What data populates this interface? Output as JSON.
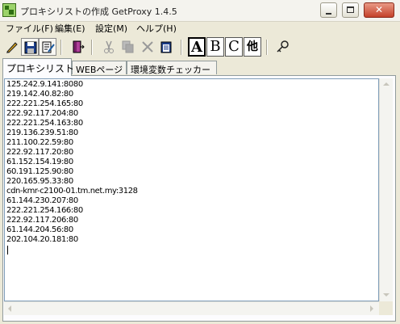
{
  "window": {
    "title": "プロキシリストの作成 GetProxy 1.4.5",
    "close_glyph": "✕"
  },
  "menu": {
    "items": [
      "ファイル(F)",
      "編集(E)",
      "設定(M)",
      "ヘルプ(H)"
    ]
  },
  "toolbar": {
    "icons": [
      "pen-icon",
      "save-icon",
      "edit-icon",
      "exit-icon",
      "cut-icon",
      "copy-icon",
      "delete-icon",
      "paste-icon",
      "key-icon"
    ],
    "mode_buttons": [
      "A",
      "B",
      "C",
      "他"
    ],
    "selected_mode": "A"
  },
  "tabs": [
    {
      "label": "プロキシリスト",
      "active": true
    },
    {
      "label": "WEBページ",
      "active": false
    },
    {
      "label": "環境変数チェッカー",
      "active": false
    }
  ],
  "proxy_list": [
    "125.242.9.141:8080",
    "219.142.40.82:80",
    "222.221.254.165:80",
    "222.92.117.204:80",
    "222.221.254.163:80",
    "219.136.239.51:80",
    "211.100.22.59:80",
    "222.92.117.20:80",
    "61.152.154.19:80",
    "60.191.125.90:80",
    "220.165.95.33:80",
    "cdn-kmr-c2100-01.tm.net.my:3128",
    "61.144.230.207:80",
    "222.221.254.166:80",
    "222.92.117.206:80",
    "61.144.204.56:80",
    "202.104.20.181:80"
  ]
}
